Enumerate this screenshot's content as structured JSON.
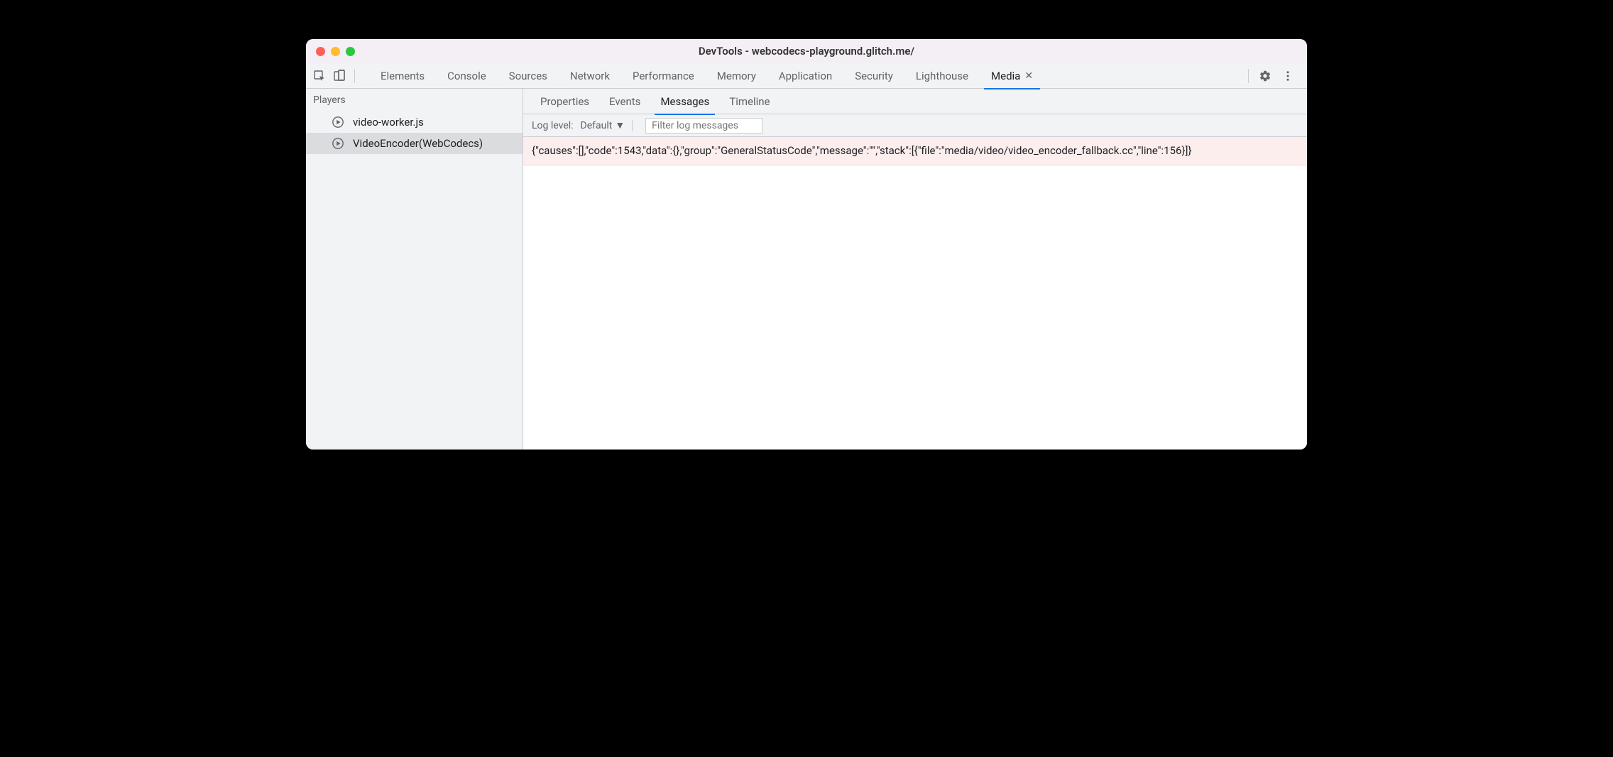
{
  "window": {
    "title": "DevTools - webcodecs-playground.glitch.me/"
  },
  "main_tabs": {
    "items": [
      {
        "label": "Elements"
      },
      {
        "label": "Console"
      },
      {
        "label": "Sources"
      },
      {
        "label": "Network"
      },
      {
        "label": "Performance"
      },
      {
        "label": "Memory"
      },
      {
        "label": "Application"
      },
      {
        "label": "Security"
      },
      {
        "label": "Lighthouse"
      },
      {
        "label": "Media"
      }
    ],
    "active_index": 9
  },
  "sidebar": {
    "header": "Players",
    "players": [
      {
        "label": "video-worker.js"
      },
      {
        "label": "VideoEncoder(WebCodecs)"
      }
    ],
    "selected_index": 1
  },
  "sub_tabs": {
    "items": [
      {
        "label": "Properties"
      },
      {
        "label": "Events"
      },
      {
        "label": "Messages"
      },
      {
        "label": "Timeline"
      }
    ],
    "active_index": 2
  },
  "filter_bar": {
    "log_level_label": "Log level:",
    "log_level_value": "Default",
    "filter_placeholder": "Filter log messages"
  },
  "log": {
    "entries": [
      "{\"causes\":[],\"code\":1543,\"data\":{},\"group\":\"GeneralStatusCode\",\"message\":\"\",\"stack\":[{\"file\":\"media/video/video_encoder_fallback.cc\",\"line\":156}]}"
    ]
  }
}
